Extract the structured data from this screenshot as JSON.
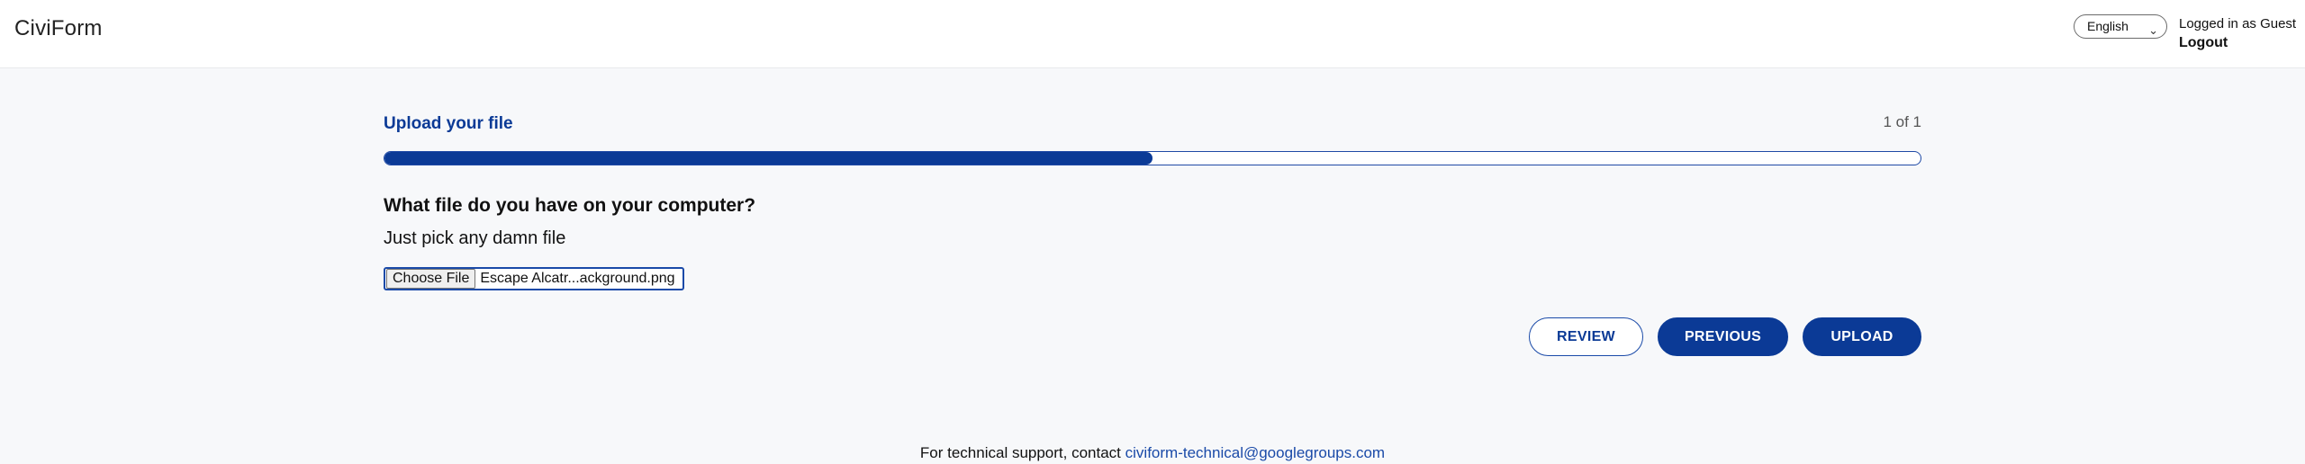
{
  "header": {
    "brand": "CiviForm",
    "language": {
      "selected": "English",
      "icon": "chevron-down-icon"
    },
    "user_status": "Logged in as Guest",
    "logout_label": "Logout"
  },
  "block": {
    "title": "Upload your file",
    "page_count": "1 of 1",
    "progress_fraction": 0.5
  },
  "question": {
    "text": "What file do you have on your computer?",
    "help": "Just pick any damn file",
    "file_button": "Choose File",
    "file_name": "Escape Alcatr...ackground.png"
  },
  "actions": {
    "review": "REVIEW",
    "previous": "PREVIOUS",
    "upload": "UPLOAD"
  },
  "footer": {
    "text": "For technical support, contact",
    "email": "civiform-technical@googlegroups.com"
  },
  "colors": {
    "accent": "#0b3a96",
    "background": "#f7f8fa"
  }
}
